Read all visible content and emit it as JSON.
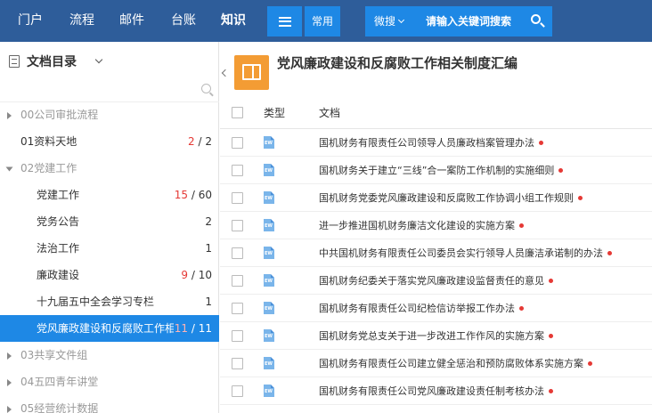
{
  "nav": {
    "items": [
      "门户",
      "流程",
      "邮件",
      "台账",
      "知识"
    ],
    "active_index": 4,
    "common_label": "常用",
    "search_scope": "微搜",
    "search_placeholder": "请输入关键词搜索"
  },
  "sidebar": {
    "title": "文档目录",
    "items": [
      {
        "label": "00公司审批流程",
        "level": 0,
        "expandable": true,
        "expanded": false,
        "muted": true,
        "count_unread": "",
        "count_total": ""
      },
      {
        "label": "01资料天地",
        "level": 0,
        "expandable": false,
        "expanded": false,
        "muted": false,
        "count_unread": "2",
        "count_total": "2"
      },
      {
        "label": "02党建工作",
        "level": 0,
        "expandable": true,
        "expanded": true,
        "muted": true,
        "count_unread": "",
        "count_total": ""
      },
      {
        "label": "党建工作",
        "level": 1,
        "expandable": false,
        "expanded": false,
        "muted": false,
        "count_unread": "15",
        "count_total": "60"
      },
      {
        "label": "党务公告",
        "level": 1,
        "expandable": false,
        "expanded": false,
        "muted": false,
        "count_unread": "",
        "count_total": "2"
      },
      {
        "label": "法治工作",
        "level": 1,
        "expandable": false,
        "expanded": false,
        "muted": false,
        "count_unread": "",
        "count_total": "1"
      },
      {
        "label": "廉政建设",
        "level": 1,
        "expandable": false,
        "expanded": false,
        "muted": false,
        "count_unread": "9",
        "count_total": "10"
      },
      {
        "label": "十九届五中全会学习专栏",
        "level": 1,
        "expandable": false,
        "expanded": false,
        "muted": false,
        "count_unread": "",
        "count_total": "1"
      },
      {
        "label": "党风廉政建设和反腐败工作相",
        "level": 1,
        "expandable": false,
        "expanded": false,
        "muted": false,
        "selected": true,
        "count_unread": "11",
        "count_total": "11"
      },
      {
        "label": "03共享文件组",
        "level": 0,
        "expandable": true,
        "expanded": false,
        "muted": true,
        "count_unread": "",
        "count_total": ""
      },
      {
        "label": "04五四青年讲堂",
        "level": 0,
        "expandable": true,
        "expanded": false,
        "muted": true,
        "count_unread": "",
        "count_total": ""
      },
      {
        "label": "05经营统计数据",
        "level": 0,
        "expandable": true,
        "expanded": false,
        "muted": true,
        "count_unread": "",
        "count_total": ""
      }
    ]
  },
  "main": {
    "title": "党风廉政建设和反腐败工作相关制度汇编",
    "columns": {
      "type": "类型",
      "doc": "文档"
    },
    "rows": [
      {
        "title": "国机财务有限责任公司领导人员廉政档案管理办法",
        "unread": true
      },
      {
        "title": "国机财务关于建立“三线”合一案防工作机制的实施细则",
        "unread": true
      },
      {
        "title": "国机财务党委党风廉政建设和反腐败工作协调小组工作规则",
        "unread": true
      },
      {
        "title": "进一步推进国机财务廉洁文化建设的实施方案",
        "unread": true
      },
      {
        "title": "中共国机财务有限责任公司委员会实行领导人员廉洁承诺制的办法",
        "unread": true
      },
      {
        "title": "国机财务纪委关于落实党风廉政建设监督责任的意见",
        "unread": true
      },
      {
        "title": "国机财务有限责任公司纪检信访举报工作办法",
        "unread": true
      },
      {
        "title": "国机财务党总支关于进一步改进工作作风的实施方案",
        "unread": true
      },
      {
        "title": "国机财务有限责任公司建立健全惩治和预防腐败体系实施方案",
        "unread": true
      },
      {
        "title": "国机财务有限责任公司党风廉政建设责任制考核办法",
        "unread": true
      }
    ]
  },
  "colors": {
    "topbar": "#2e5d9a",
    "accent": "#1e88e5",
    "book_icon": "#f39c34",
    "unread_red": "#e53935"
  }
}
